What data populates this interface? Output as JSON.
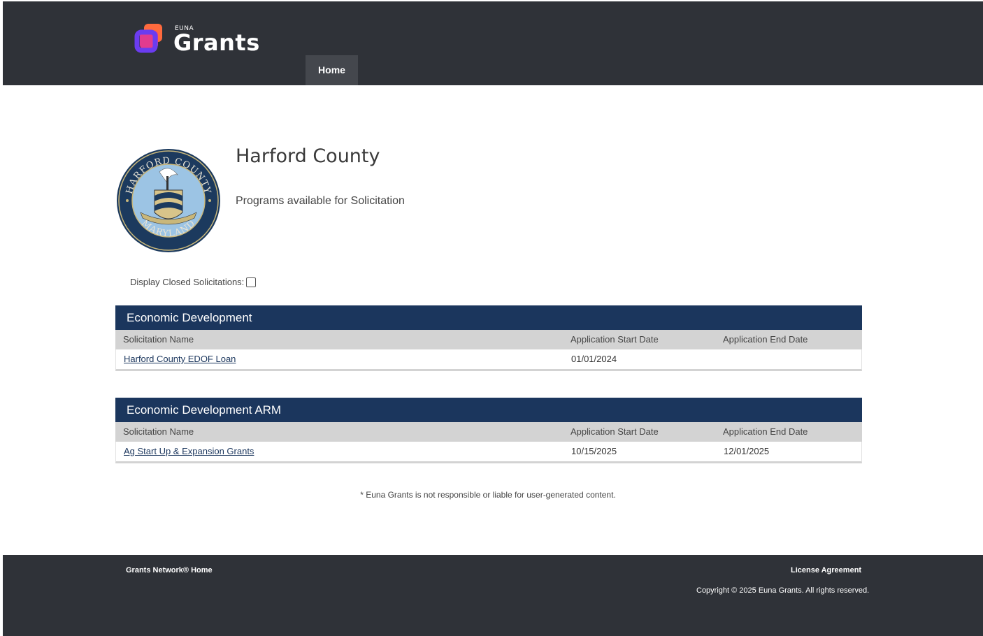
{
  "header": {
    "logo_small": "EUNA",
    "logo_big": "Grants",
    "nav": {
      "home": "Home"
    }
  },
  "org": {
    "title": "Harford County",
    "subtitle": "Programs available for Solicitation",
    "seal_text_top": "HARFORD COUNTY",
    "seal_text_bottom": "MARYLAND"
  },
  "filter": {
    "closed_label": "Display Closed Solicitations:",
    "closed_checked": false
  },
  "columns": {
    "name": "Solicitation Name",
    "start": "Application Start Date",
    "end": "Application End Date"
  },
  "sections": [
    {
      "title": "Economic Development",
      "rows": [
        {
          "name": "Harford County EDOF Loan",
          "start": "01/01/2024",
          "end": ""
        }
      ]
    },
    {
      "title": "Economic Development ARM",
      "rows": [
        {
          "name": "Ag Start Up & Expansion Grants",
          "start": "10/15/2025",
          "end": "12/01/2025"
        }
      ]
    }
  ],
  "disclaimer": "* Euna Grants is not responsible or liable for user-generated content.",
  "footer": {
    "network_home": "Grants Network® Home",
    "license": "License Agreement",
    "copyright": "Copyright © 2025 Euna Grants. All rights reserved."
  },
  "colors": {
    "header_bg": "#2f3238",
    "section_bg": "#1b365d",
    "logo_purple": "#6b3cf0",
    "logo_orange": "#ff6a3d"
  }
}
